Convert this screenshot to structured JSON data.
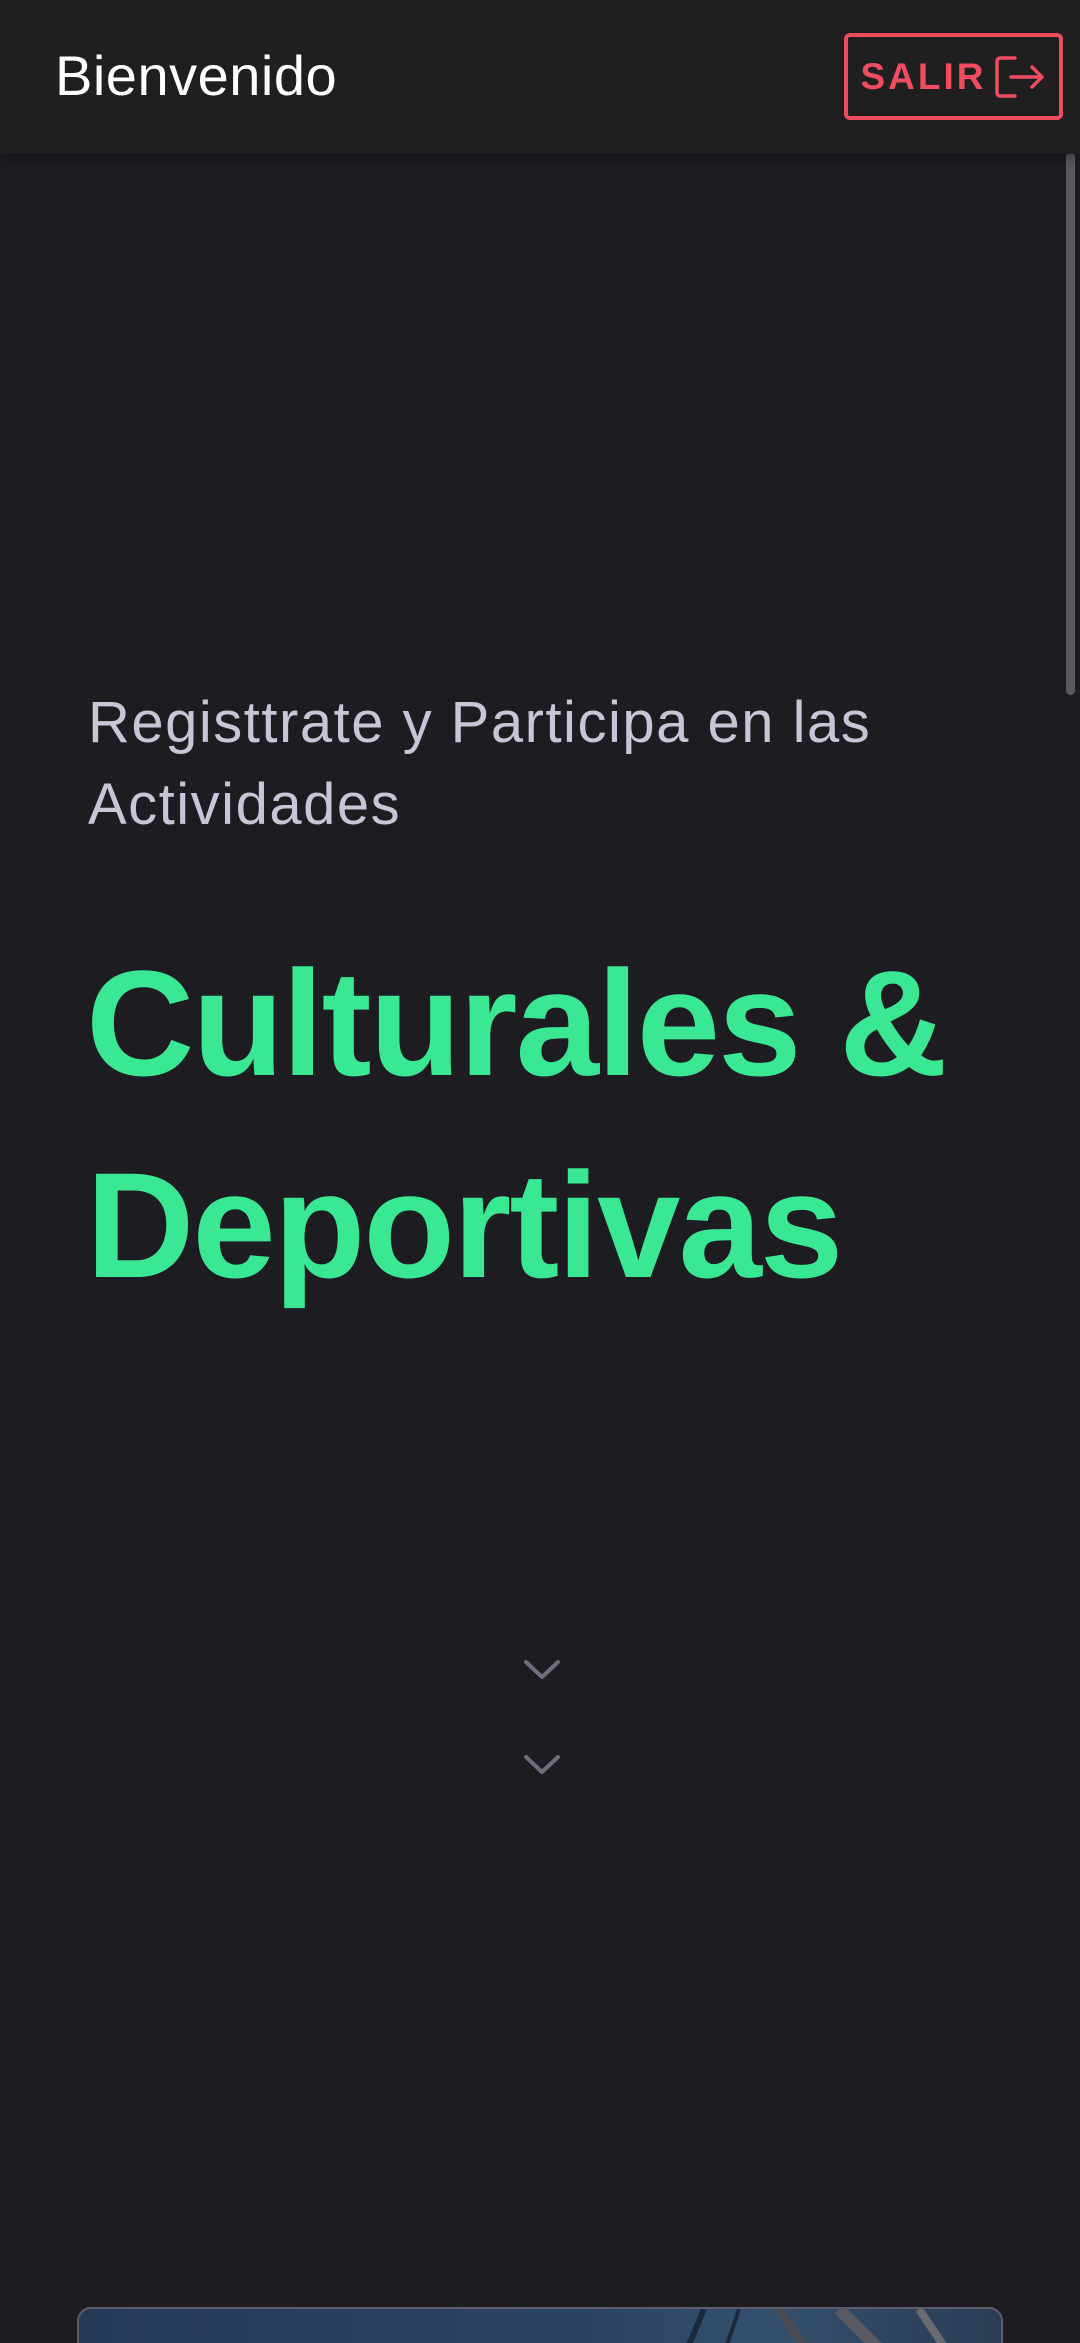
{
  "header": {
    "title": "Bienvenido",
    "logout_label": "SALIR",
    "logout_icon": "logout-icon"
  },
  "hero": {
    "subtitle": "Registtrate y Participa en las Actividades",
    "title_line1": "Culturales &",
    "title_line2": "Deportivas"
  },
  "scroll_hint": {
    "icons": [
      "chevron-down-icon",
      "chevron-down-icon"
    ]
  },
  "colors": {
    "background": "#1d1c21",
    "topbar": "#1f1f1f",
    "accent_green": "#3ae894",
    "danger_red": "#ef4b61",
    "subtitle_text": "#c7c6d6",
    "chevron": "#6e6e7e"
  }
}
